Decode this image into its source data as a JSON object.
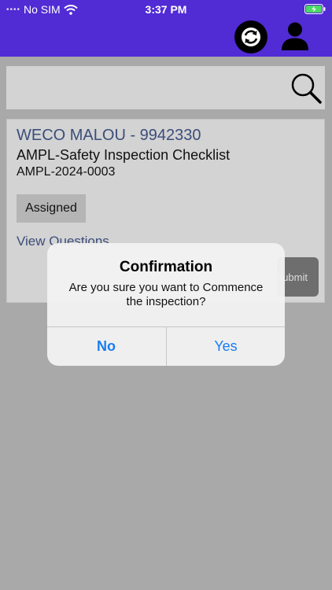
{
  "status_bar": {
    "carrier": "No SIM",
    "time": "3:37 PM"
  },
  "header": {
    "sync_icon": "sync-icon",
    "user_icon": "user-icon",
    "bar_color": "#512bd4"
  },
  "search": {
    "icon": "search-icon"
  },
  "card": {
    "vessel": "WECO MALOU - 9942330",
    "checklist": "AMPL-Safety Inspection Checklist",
    "reference": "AMPL-2024-0003",
    "status": "Assigned",
    "view_questions": "View Questions",
    "submit_label": "Submit"
  },
  "dialog": {
    "title": "Confirmation",
    "message": "Are you sure you want to Commence the inspection?",
    "no_label": "No",
    "yes_label": "Yes",
    "button_color": "#1a7cf0"
  }
}
